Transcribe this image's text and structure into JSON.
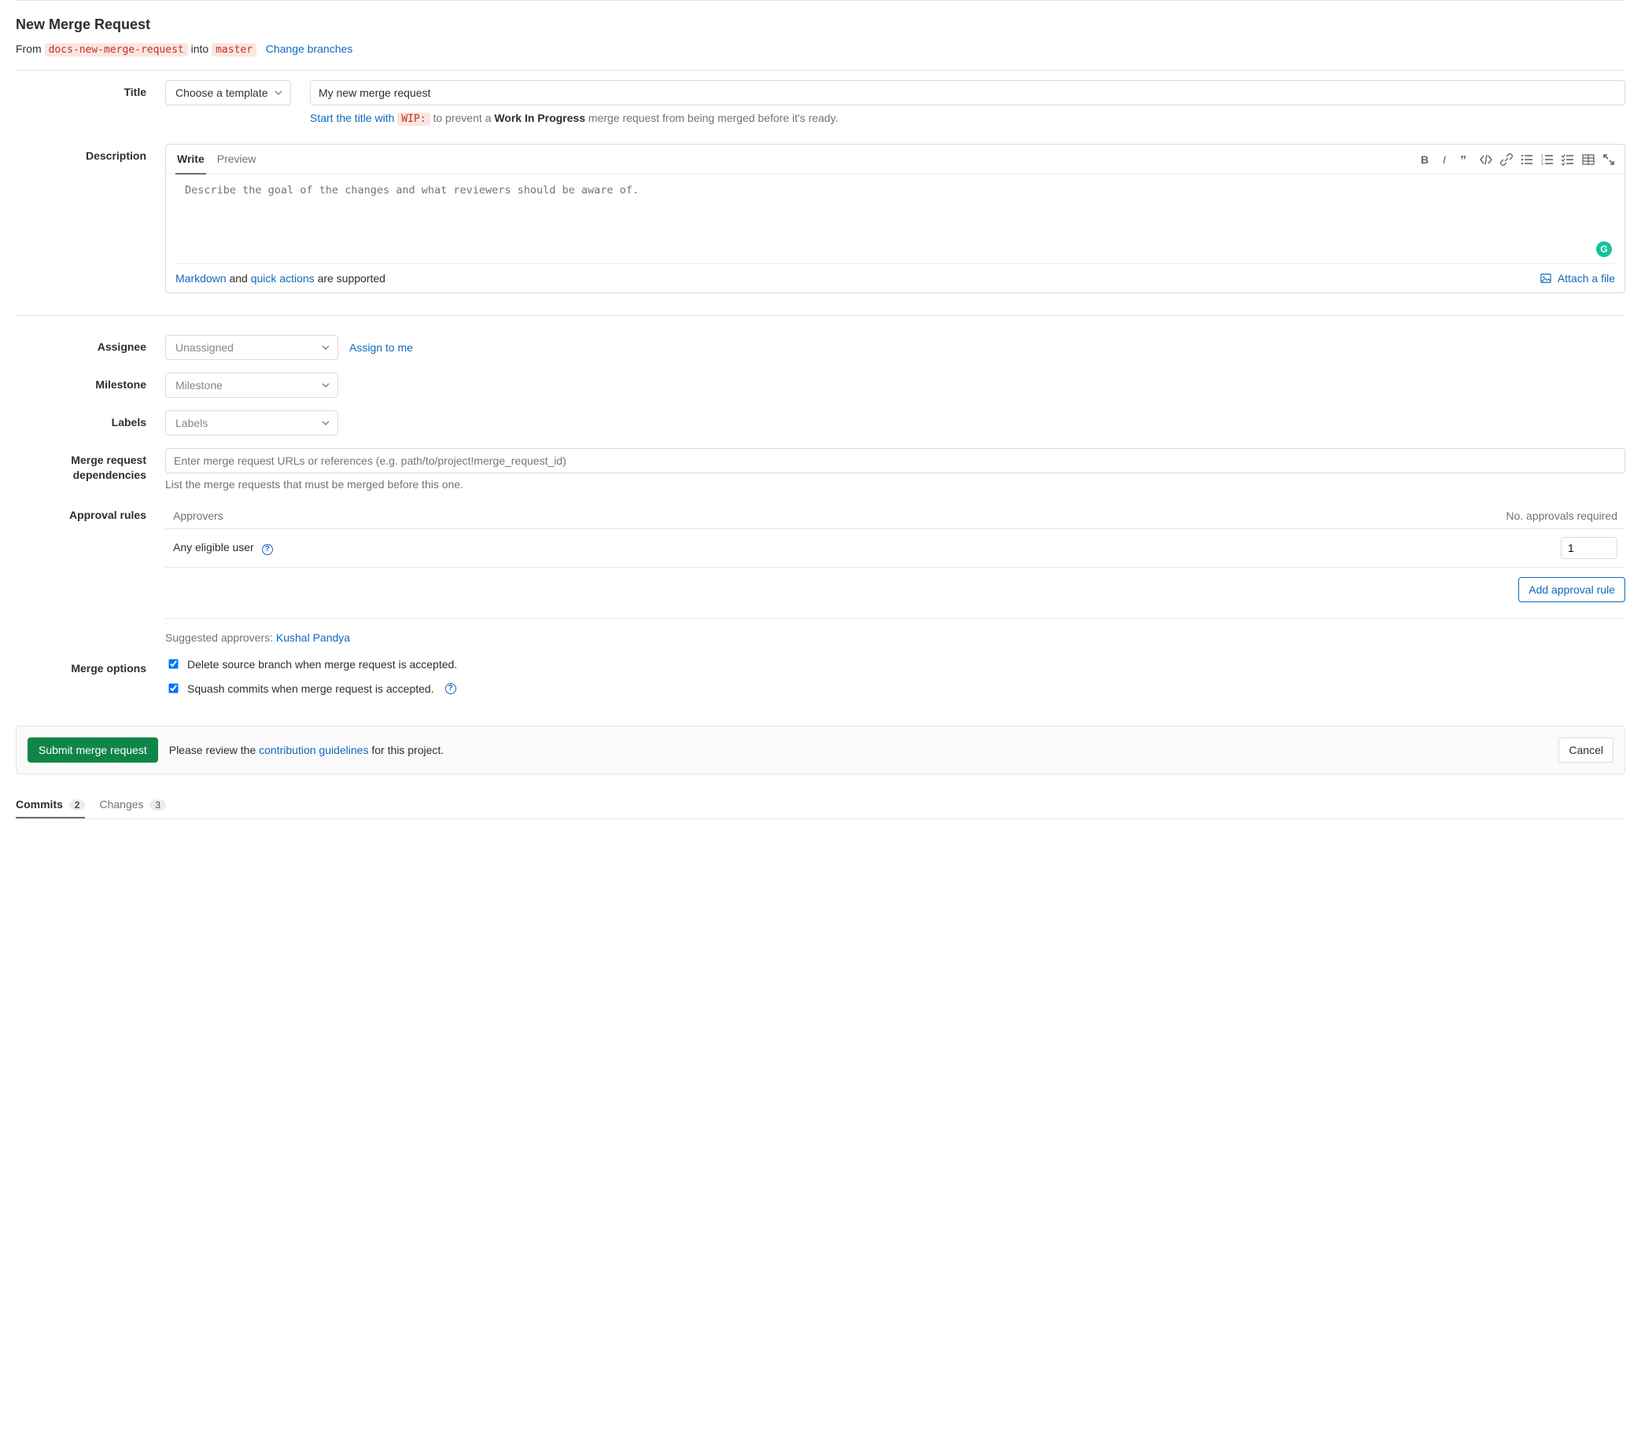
{
  "header": {
    "title": "New Merge Request",
    "from_label": "From",
    "from_branch": "docs-new-merge-request",
    "into_label": "into",
    "into_branch": "master",
    "change_branches": "Change branches"
  },
  "fields": {
    "title_label": "Title",
    "template_placeholder": "Choose a template",
    "title_value": "My new merge request",
    "wip_hint_prefix_link": "Start the title with",
    "wip_tag": "WIP:",
    "wip_hint_mid": "to prevent a",
    "wip_bold": "Work In Progress",
    "wip_hint_suffix": "merge request from being merged before it's ready.",
    "description_label": "Description",
    "tabs": {
      "write": "Write",
      "preview": "Preview"
    },
    "desc_placeholder": "Describe the goal of the changes and what reviewers should be aware of.",
    "desc_footer": {
      "markdown_link": "Markdown",
      "and": "and",
      "quick_actions_link": "quick actions",
      "supported": "are supported",
      "attach_label": "Attach a file"
    },
    "assignee_label": "Assignee",
    "assignee_placeholder": "Unassigned",
    "assign_to_me": "Assign to me",
    "milestone_label": "Milestone",
    "milestone_placeholder": "Milestone",
    "labels_label": "Labels",
    "labels_placeholder": "Labels",
    "deps_label_line1": "Merge request",
    "deps_label_line2": "dependencies",
    "deps_placeholder": "Enter merge request URLs or references (e.g. path/to/project!merge_request_id)",
    "deps_note": "List the merge requests that must be merged before this one.",
    "approval_label": "Approval rules",
    "approval_col1": "Approvers",
    "approval_col2": "No. approvals required",
    "approval_row_label": "Any eligible user",
    "approval_count": "1",
    "add_rule": "Add approval rule",
    "suggested_prefix": "Suggested approvers:",
    "suggested_name": "Kushal Pandya",
    "merge_options_label": "Merge options",
    "opt_delete": "Delete source branch when merge request is accepted.",
    "opt_squash": "Squash commits when merge request is accepted."
  },
  "submit": {
    "button": "Submit merge request",
    "review_prefix": "Please review the",
    "guidelines_link": "contribution guidelines",
    "review_suffix": "for this project.",
    "cancel": "Cancel"
  },
  "bottom_tabs": {
    "commits_label": "Commits",
    "commits_count": "2",
    "changes_label": "Changes",
    "changes_count": "3"
  }
}
